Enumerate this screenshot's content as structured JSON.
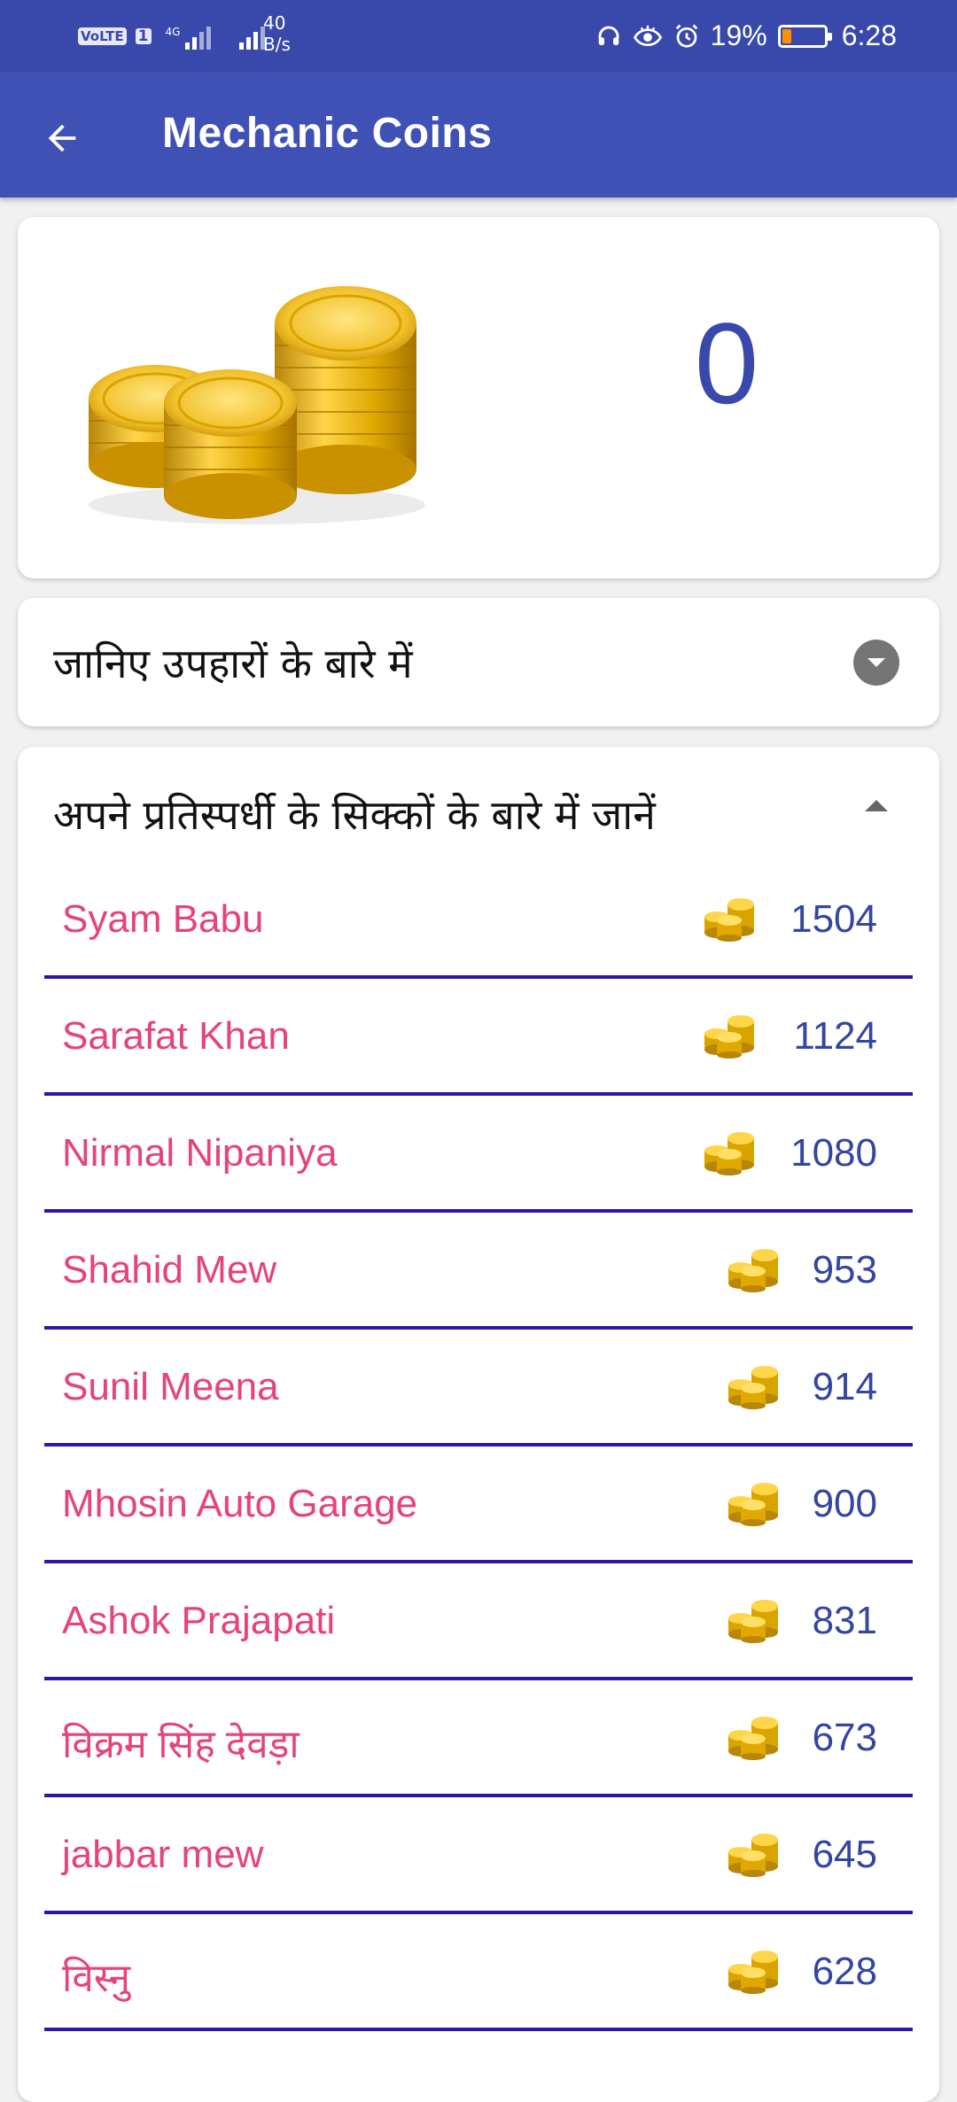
{
  "status_bar": {
    "volte": "VoLTE",
    "sim": "1",
    "network_type": "4G",
    "speed_value": "40",
    "speed_unit": "B/s",
    "battery_percent": "19%",
    "time": "6:28",
    "battery_level": 0.19
  },
  "app_bar": {
    "title": "Mechanic Coins",
    "back_icon": "arrow-left-icon"
  },
  "coin_card": {
    "balance": "0",
    "image": "gold-coin-stack"
  },
  "gifts_section": {
    "title": "जानिए उपहारों के बारे में",
    "icon": "dropdown-circle-icon"
  },
  "rivals_section": {
    "title": "अपने प्रतिस्पर्धी के सिक्कों के बारे में जानें",
    "icon": "triangle-up-icon",
    "rows": [
      {
        "name": "Syam Babu",
        "coins": "1504"
      },
      {
        "name": "Sarafat Khan",
        "coins": "1124"
      },
      {
        "name": "Nirmal Nipaniya",
        "coins": "1080"
      },
      {
        "name": "Shahid Mew",
        "coins": "953"
      },
      {
        "name": "Sunil Meena",
        "coins": "914"
      },
      {
        "name": "Mhosin Auto Garage",
        "coins": "900"
      },
      {
        "name": "Ashok Prajapati",
        "coins": "831"
      },
      {
        "name": "विक्रम सिंह देवड़ा",
        "coins": "673"
      },
      {
        "name": "jabbar mew",
        "coins": "645"
      },
      {
        "name": "विस्नु",
        "coins": "628"
      },
      {
        "name": "",
        "coins": ""
      }
    ]
  },
  "colors": {
    "status_bar": "#3948ab",
    "app_bar": "#3f51b5",
    "name_text": "#e6437a",
    "coin_text": "#3346a0",
    "divider": "#2b17a6"
  }
}
